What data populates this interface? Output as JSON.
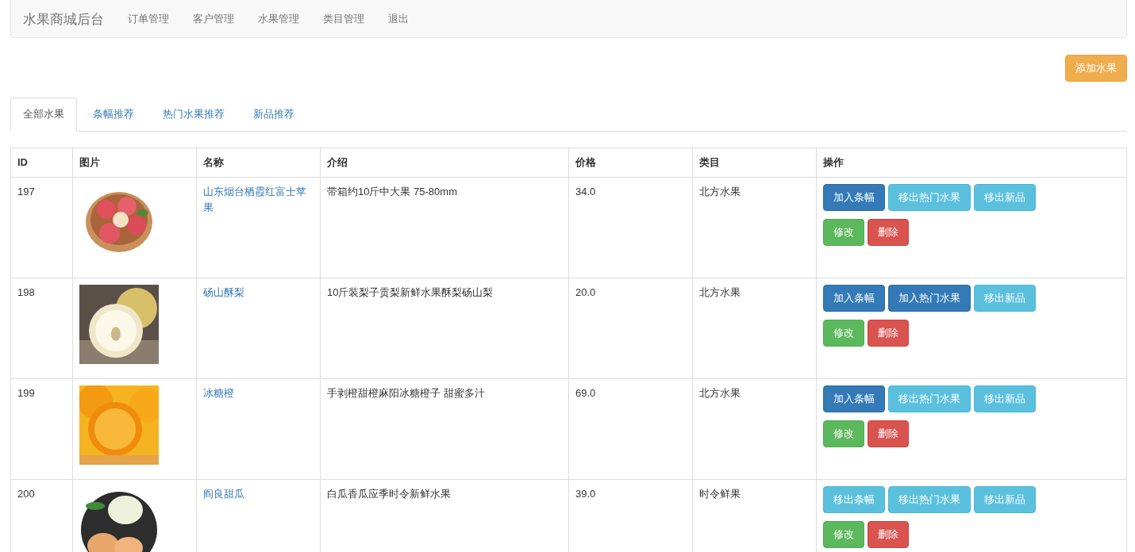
{
  "navbar": {
    "brand": "水果商城后台",
    "links": [
      "订单管理",
      "客户管理",
      "水果管理",
      "类目管理",
      "退出"
    ]
  },
  "add_button": "添加水果",
  "tabs": [
    {
      "label": "全部水果",
      "selected": true
    },
    {
      "label": "条幅推荐",
      "selected": false
    },
    {
      "label": "热门水果推荐",
      "selected": false
    },
    {
      "label": "新品推荐",
      "selected": false
    }
  ],
  "table": {
    "columns": [
      "ID",
      "图片",
      "名称",
      "介绍",
      "价格",
      "类目",
      "操作"
    ],
    "rows": [
      {
        "id": "197",
        "name": "山东烟台栖霞红富士苹果",
        "intro": "带箱约10斤中大果 75-80mm",
        "price": "34.0",
        "category": "北方水果",
        "actions": [
          {
            "label": "加入条幅",
            "kind": "primary"
          },
          {
            "label": "移出热门水果",
            "kind": "info"
          },
          {
            "label": "移出新品",
            "kind": "info"
          },
          {
            "label": "修改",
            "kind": "success"
          },
          {
            "label": "删除",
            "kind": "danger"
          }
        ]
      },
      {
        "id": "198",
        "name": "砀山酥梨",
        "intro": "10斤装梨子贡梨新鲜水果酥梨砀山梨",
        "price": "20.0",
        "category": "北方水果",
        "actions": [
          {
            "label": "加入条幅",
            "kind": "primary"
          },
          {
            "label": "加入热门水果",
            "kind": "primary"
          },
          {
            "label": "移出新品",
            "kind": "info"
          },
          {
            "label": "修改",
            "kind": "success"
          },
          {
            "label": "删除",
            "kind": "danger"
          }
        ]
      },
      {
        "id": "199",
        "name": "冰糖橙",
        "intro": "手剥橙甜橙麻阳冰糖橙子 甜蜜多汁",
        "price": "69.0",
        "category": "北方水果",
        "actions": [
          {
            "label": "加入条幅",
            "kind": "primary"
          },
          {
            "label": "移出热门水果",
            "kind": "info"
          },
          {
            "label": "移出新品",
            "kind": "info"
          },
          {
            "label": "修改",
            "kind": "success"
          },
          {
            "label": "删除",
            "kind": "danger"
          }
        ]
      },
      {
        "id": "200",
        "name": "阎良甜瓜",
        "intro": "白瓜香瓜应季时令新鲜水果",
        "price": "39.0",
        "category": "时令鲜果",
        "actions": [
          {
            "label": "移出条幅",
            "kind": "info"
          },
          {
            "label": "移出热门水果",
            "kind": "info"
          },
          {
            "label": "移出新品",
            "kind": "info"
          },
          {
            "label": "修改",
            "kind": "success"
          },
          {
            "label": "删除",
            "kind": "danger"
          }
        ]
      }
    ]
  }
}
